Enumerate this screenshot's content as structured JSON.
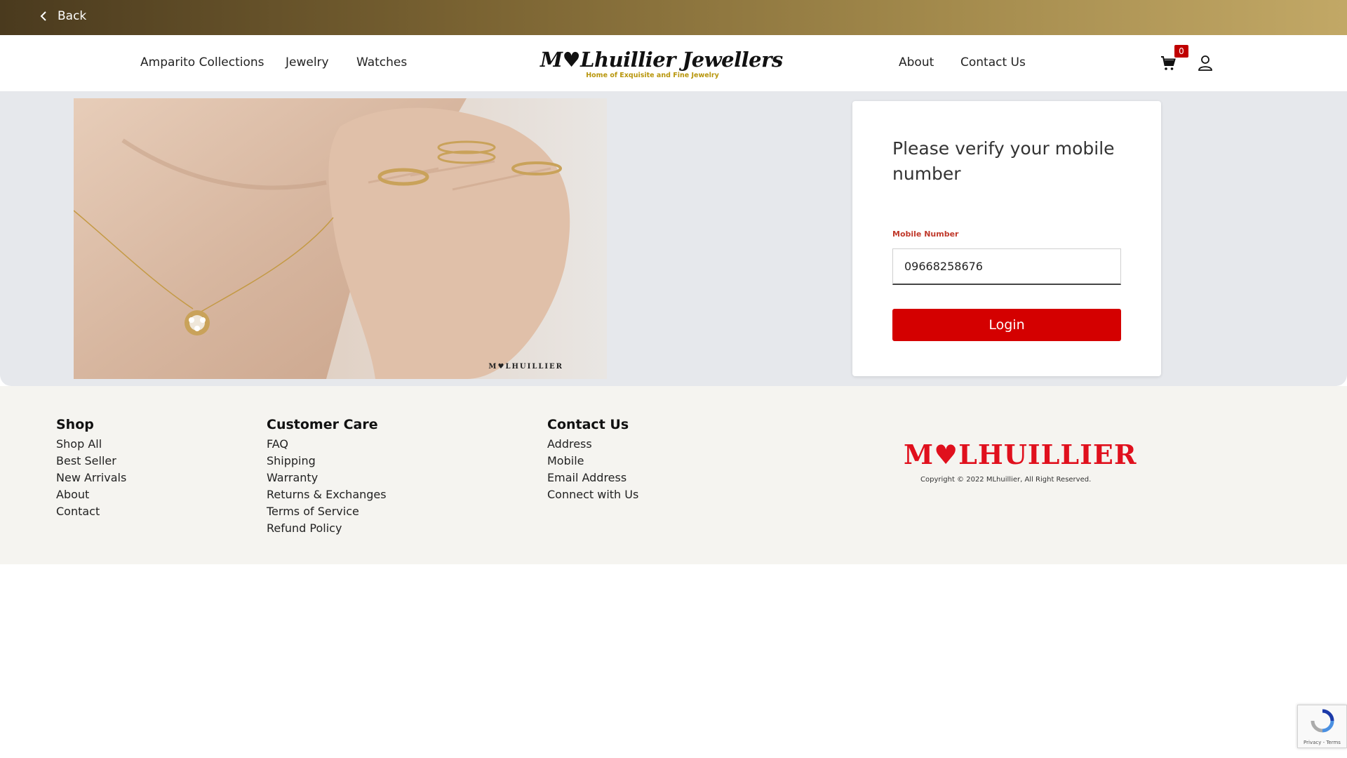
{
  "topbar": {
    "back_label": "Back"
  },
  "nav": {
    "left": [
      "Amparito Collections",
      "Jewelry",
      "Watches"
    ],
    "right": [
      "About",
      "Contact Us"
    ]
  },
  "logo": {
    "main": "M♥Lhuillier Jewellers",
    "tagline": "Home of Exquisite and Fine Jewelry"
  },
  "cart": {
    "count": "0"
  },
  "hero": {
    "brand_mark": "M♥LHUILLIER"
  },
  "login_card": {
    "title": "Please verify your mobile number",
    "field_label": "Mobile Number",
    "field_value": "09668258676",
    "button_label": "Login"
  },
  "footer": {
    "shop": {
      "heading": "Shop",
      "links": [
        "Shop All",
        "Best Seller",
        "New Arrivals",
        "About",
        "Contact"
      ]
    },
    "care": {
      "heading": "Customer Care",
      "links": [
        "FAQ",
        "Shipping",
        "Warranty",
        "Returns & Exchanges",
        "Terms of Service",
        "Refund Policy"
      ]
    },
    "contact": {
      "heading": "Contact Us",
      "links": [
        "Address",
        "Mobile",
        "Email Address",
        "Connect with Us"
      ]
    },
    "logo_text": "M♥LHUILLIER",
    "copyright": "Copyright © 2022 MLhuillier, All Right Reserved."
  },
  "recaptcha": {
    "links": "Privacy - Terms"
  },
  "colors": {
    "accent": "#d40000",
    "gold": "#a38a4c",
    "brand_red": "#e0101d"
  }
}
